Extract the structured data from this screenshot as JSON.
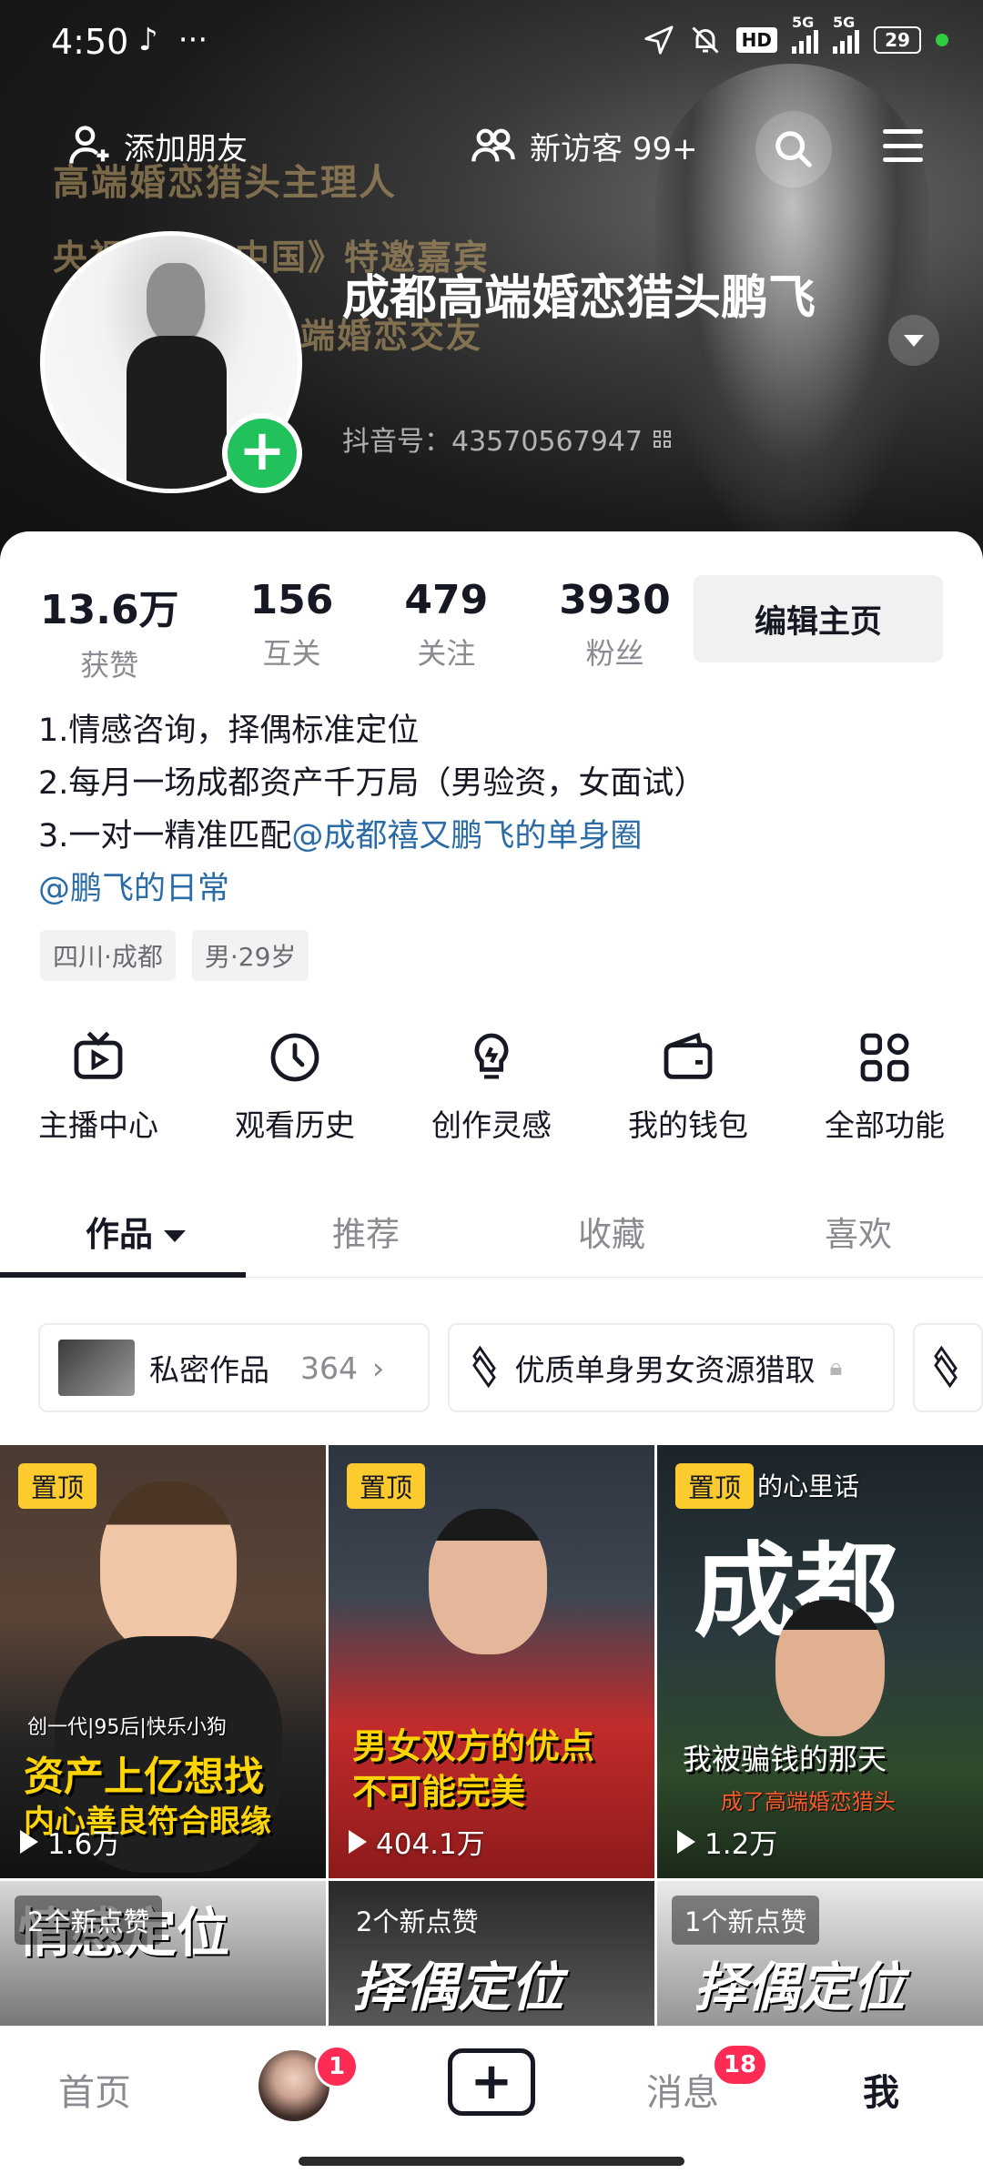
{
  "status_bar": {
    "time": "4:50",
    "hd_label": "HD",
    "network_1": "5G",
    "network_2": "5G",
    "battery": "29"
  },
  "header": {
    "add_friend_label": "添加朋友",
    "visitors_label": "新访客 99+",
    "banner_line_1": "高端婚恋猎头主理人",
    "banner_line_2": "央视《……中国》特邀嘉宾",
    "banner_line_3": "端婚恋交友"
  },
  "profile": {
    "nickname": "成都高端婚恋猎头鹏飞",
    "douyin_id": "抖音号：43570567947",
    "stats": [
      {
        "num": "13.6万",
        "label": "获赞"
      },
      {
        "num": "156",
        "label": "互关"
      },
      {
        "num": "479",
        "label": "关注"
      },
      {
        "num": "3930",
        "label": "粉丝"
      }
    ],
    "edit_label": "编辑主页",
    "bio_line_1": "1.情感咨询，择偶标准定位",
    "bio_line_2": "2.每月一场成都资产千万局（男验资，女面试）",
    "bio_line_3_prefix": "3.一对一精准匹配",
    "bio_mention_1": "@成都禧又鹏飞的单身圈",
    "bio_mention_2": "@鹏飞的日常",
    "tags": [
      "四川·成都",
      "男·29岁"
    ]
  },
  "tools": [
    {
      "label": "主播中心",
      "icon": "tv-icon"
    },
    {
      "label": "观看历史",
      "icon": "clock-icon"
    },
    {
      "label": "创作灵感",
      "icon": "lightbulb-icon"
    },
    {
      "label": "我的钱包",
      "icon": "wallet-icon"
    },
    {
      "label": "全部功能",
      "icon": "grid-icon"
    }
  ],
  "tabs": [
    "作品",
    "推荐",
    "收藏",
    "喜欢"
  ],
  "collections": {
    "private_label": "私密作品",
    "private_count": "364",
    "playlist_label": "优质单身男女资源猎取"
  },
  "videos": [
    {
      "pin": "置顶",
      "top_text": "创一代|95后|快乐小狗",
      "title_1": "资产上亿想找",
      "title_2": "内心善良符合眼缘",
      "views": "1.6万"
    },
    {
      "pin": "置顶",
      "title_1": "男女双方的优点",
      "title_2": "不可能完美",
      "views": "404.1万"
    },
    {
      "pin": "置顶",
      "corner_text": "的心里话",
      "big_text": "成都",
      "title_1": "我被骗钱的那天",
      "title_2": "成了高端婚恋猎头",
      "views": "1.2万"
    },
    {
      "newlikes": "2个新点赞",
      "big_text": "情感定位"
    },
    {
      "newlikes": "2个新点赞",
      "big_text": "择偶定位"
    },
    {
      "newlikes": "1个新点赞",
      "big_text": "择偶定位"
    }
  ],
  "bottom_nav": {
    "home": "首页",
    "avatar_badge": "1",
    "plus": "+",
    "messages": "消息",
    "messages_badge": "18",
    "me": "我"
  },
  "colors": {
    "accent_red": "#fe2c55",
    "pin_yellow": "#fecb2f",
    "mention_blue": "#2b6ba6",
    "add_green": "#21c15b"
  }
}
